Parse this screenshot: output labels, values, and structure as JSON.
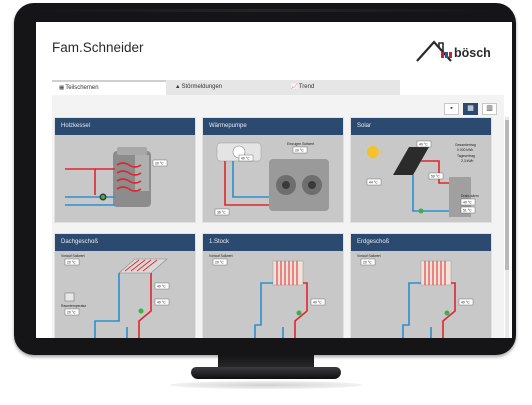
{
  "header": {
    "title": "Fam.Schneider",
    "logo_text": "bösch"
  },
  "tabs": [
    {
      "label": "Teilschemen",
      "icon": "grid-icon",
      "active": true
    },
    {
      "label": "Störmeldungen",
      "icon": "warning-icon",
      "active": false
    },
    {
      "label": "Trend",
      "icon": "chart-icon",
      "active": false
    }
  ],
  "view_toggle": [
    {
      "name": "grid-large-view-icon",
      "active": false
    },
    {
      "name": "grid-medium-view-icon",
      "active": true
    },
    {
      "name": "list-view-icon",
      "active": false
    }
  ],
  "panels": [
    {
      "title": "Holzkessel",
      "readings": [
        "20 °C"
      ]
    },
    {
      "title": "Wärmepumpe",
      "readings": [
        "Einzugen Sollwert",
        "20 °C",
        "40 °C",
        "36 °C"
      ]
    },
    {
      "title": "Solar",
      "readings": [
        "Gesamtertrag",
        "0.000 kWh",
        "Tagesertrag",
        "2,3 kWh",
        "Drain-wärm",
        "40 °C",
        "44 °C",
        "50 °C",
        "40 °C",
        "51 °C"
      ]
    },
    {
      "title": "Dachgeschoß",
      "readings": [
        "Vorlauf Sollwert",
        "20 °C",
        "Raumtemperatur",
        "20 °C",
        "40 °C",
        "40 °C"
      ]
    },
    {
      "title": "1.Stock",
      "readings": [
        "Vorlauf Sollwert",
        "20 °C",
        "40 °C"
      ]
    },
    {
      "title": "Erdgeschoß",
      "readings": [
        "Vorlauf Sollwert",
        "20 °C",
        "40 °C"
      ]
    }
  ],
  "colors": {
    "panel_header": "#2c4a70",
    "pipe_hot": "#e0262f",
    "pipe_cold": "#2a8fd1",
    "panel_bg": "#c8c8c8"
  }
}
